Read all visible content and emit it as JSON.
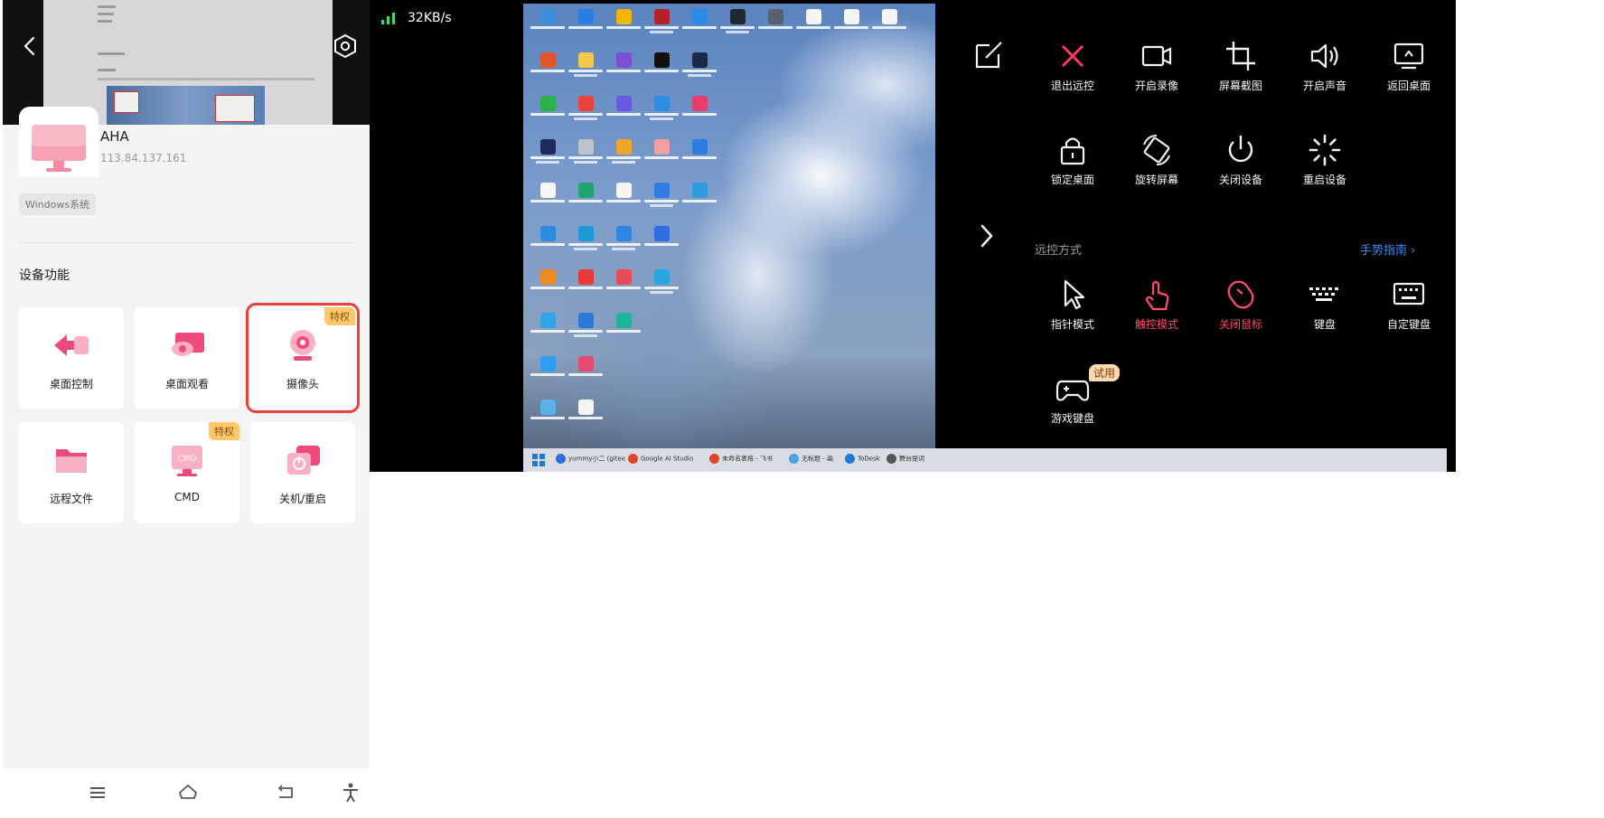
{
  "device": {
    "name": "AHA",
    "ip": "113.84.137.161",
    "os_tag": "Windows系统",
    "section_title": "设备功能"
  },
  "features": [
    {
      "label": "桌面控制",
      "badge": "",
      "icon": "desktop-control-icon"
    },
    {
      "label": "桌面观看",
      "badge": "",
      "icon": "desktop-view-icon"
    },
    {
      "label": "摄像头",
      "badge": "特权",
      "icon": "camera-icon"
    },
    {
      "label": "远程文件",
      "badge": "",
      "icon": "folder-icon"
    },
    {
      "label": "CMD",
      "badge": "特权",
      "icon": "cmd-icon"
    },
    {
      "label": "关机/重启",
      "badge": "",
      "icon": "power-icon"
    }
  ],
  "remote": {
    "speed": "32KB/s",
    "menu_row1": [
      "退出远控",
      "开启录像",
      "屏幕截图",
      "开启声音",
      "返回桌面"
    ],
    "menu_row2": [
      "锁定桌面",
      "旋转屏幕",
      "关闭设备",
      "重启设备"
    ],
    "mode_label": "远控方式",
    "gesture_guide": "手势指南",
    "mode_row": [
      "指针模式",
      "触控模式",
      "关闭鼠标",
      "键盘",
      "自定键盘"
    ],
    "game_keyboard": "游戏键盘",
    "trial_badge": "试用",
    "taskbar_items": [
      "yummy小二 (gitee",
      "Google AI Studio",
      "未命名表格 - 飞书",
      "无标题 - 画",
      "ToDesk",
      "舞台提词"
    ]
  },
  "colors": {
    "accent_pink": "#f04a7a",
    "badge_orange": "#ffc86b",
    "highlight_red": "#e6423e",
    "active_mode_red": "#ff4d6d",
    "link_blue": "#3d8bff"
  }
}
